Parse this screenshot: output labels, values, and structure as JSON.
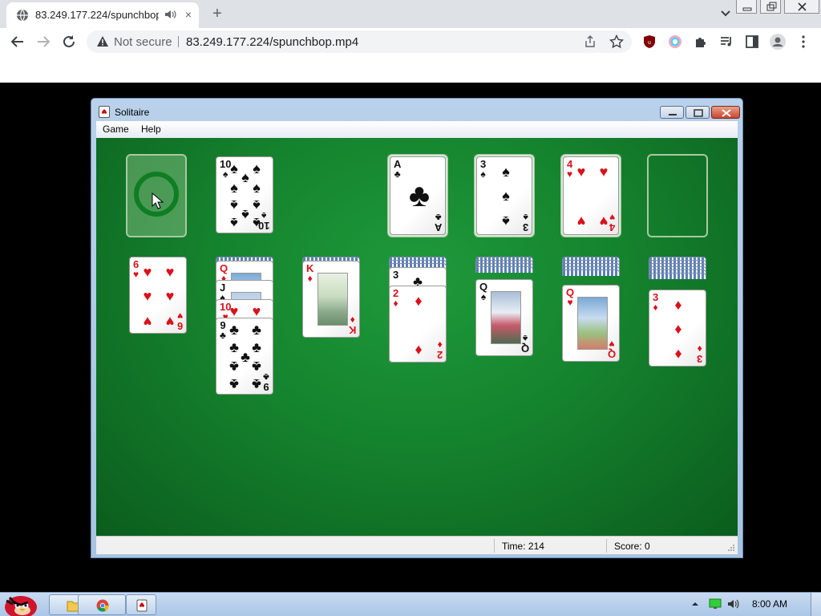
{
  "browser": {
    "tab_title": "83.249.177.224/spunchbop.mp4",
    "security_label": "Not secure",
    "url": "83.249.177.224/spunchbop.mp4",
    "new_tab_glyph": "+",
    "close_tab_glyph": "×"
  },
  "window": {
    "title": "Solitaire",
    "menu": [
      "Game",
      "Help"
    ],
    "status": {
      "time_label": "Time:  214",
      "score_label": "Score: 0"
    }
  },
  "board": {
    "stock": "empty (recycle)",
    "waste": [
      {
        "rank": "10",
        "suit": "♠",
        "color": "black"
      }
    ],
    "foundations": [
      {
        "rank": "A",
        "suit": "♣",
        "color": "black"
      },
      {
        "rank": "3",
        "suit": "♠",
        "color": "black"
      },
      {
        "rank": "4",
        "suit": "♥",
        "color": "red"
      },
      null
    ],
    "tableau": [
      {
        "hidden": 0,
        "cards": [
          {
            "rank": "6",
            "suit": "♥",
            "color": "red"
          }
        ]
      },
      {
        "hidden": 1,
        "cards": [
          {
            "rank": "Q",
            "suit": "♦",
            "color": "red"
          },
          {
            "rank": "J",
            "suit": "♠",
            "color": "black"
          },
          {
            "rank": "10",
            "suit": "♥",
            "color": "red"
          },
          {
            "rank": "9",
            "suit": "♣",
            "color": "black"
          }
        ]
      },
      {
        "hidden": 1,
        "cards": [
          {
            "rank": "K",
            "suit": "♦",
            "color": "red"
          }
        ]
      },
      {
        "hidden": 3,
        "cards": [
          {
            "rank": "3",
            "suit": "♣",
            "color": "black"
          },
          {
            "rank": "2",
            "suit": "♦",
            "color": "red"
          }
        ]
      },
      {
        "hidden": 4,
        "cards": [
          {
            "rank": "Q",
            "suit": "♠",
            "color": "black"
          }
        ]
      },
      {
        "hidden": 5,
        "cards": [
          {
            "rank": "Q",
            "suit": "♥",
            "color": "red"
          }
        ]
      },
      {
        "hidden": 6,
        "cards": [
          {
            "rank": "3",
            "suit": "♦",
            "color": "red"
          }
        ]
      }
    ]
  },
  "taskbar": {
    "clock": "8:00 AM"
  },
  "colors": {
    "felt": "#15832e",
    "red_suit": "#d9111b",
    "black_suit": "#111111"
  },
  "icons": {
    "tab": [
      "globe-icon",
      "speaker-icon",
      "close-icon",
      "plus-icon",
      "chevron-down-icon"
    ],
    "toolbar": [
      "back-arrow-icon",
      "forward-arrow-icon",
      "reload-icon",
      "warning-icon",
      "share-icon",
      "star-icon",
      "ublock-icon",
      "profile-ring-icon",
      "puzzle-icon",
      "media-icon",
      "sidepanel-icon",
      "account-icon",
      "kebab-menu-icon"
    ]
  }
}
